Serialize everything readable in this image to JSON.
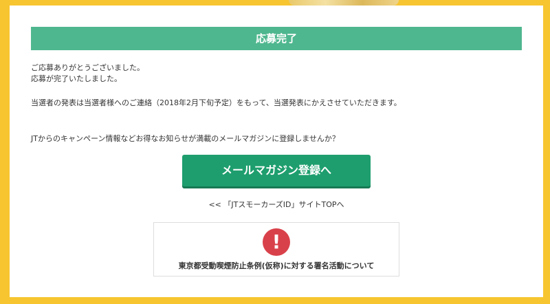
{
  "page": {
    "title": "応募完了",
    "messages": [
      "ご応募ありがとうございました。",
      "応募が完了いたしました。",
      "当選者の発表は当選者様へのご連絡（2018年2月下旬予定）をもって、当選発表にかえさせていただきます。",
      "JTからのキャンペーン情報などお得なお知らせが満載のメールマガジンに登録しませんか？"
    ],
    "mail_button_label": "メールマガジン登録へ",
    "back_link_text": "<< 「JTスモーカーズID」サイトTOPへ",
    "notice": {
      "icon_glyph": "!",
      "icon_name": "exclamation-icon",
      "text": "東京都受動喫煙防止条例(仮称)に対する署名活動について"
    }
  },
  "colors": {
    "background": "#f7c530",
    "title_bar": "#4fb78f",
    "button": "#1e9e6e",
    "alert": "#d9414a"
  }
}
